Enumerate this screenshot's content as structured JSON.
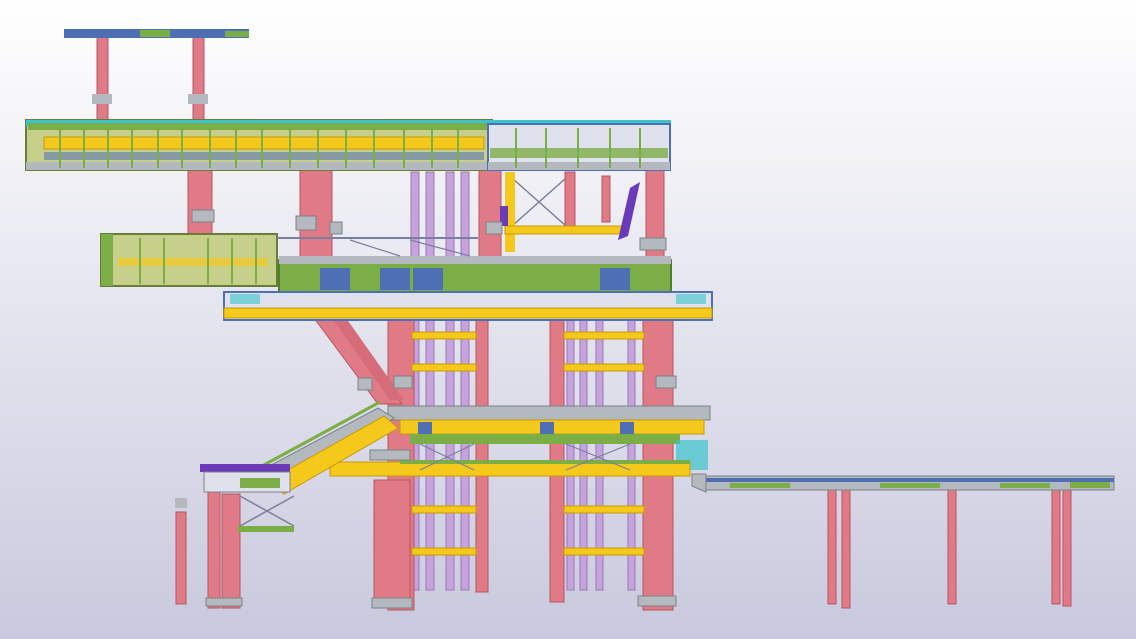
{
  "viewport": {
    "background_top": "#ffffff",
    "background_bottom": "#c9c9de"
  },
  "palette": {
    "column": "#e07a86",
    "column_edge": "#b65563",
    "yellow": "#f5c81c",
    "yellow_edge": "#c89a0a",
    "green": "#7cae47",
    "green_edge": "#4f7f2a",
    "olive": "#c7d08a",
    "grey": "#b4b8bf",
    "grey_edge": "#7d8289",
    "blue": "#4e6fb4",
    "purple": "#c6a3dc",
    "purple_edge": "#9a78b4",
    "violet": "#6a3ab8",
    "cyan": "#3ac5cc",
    "brace": "#7a7f9e"
  },
  "icons": [
    "steel-structure-model"
  ]
}
